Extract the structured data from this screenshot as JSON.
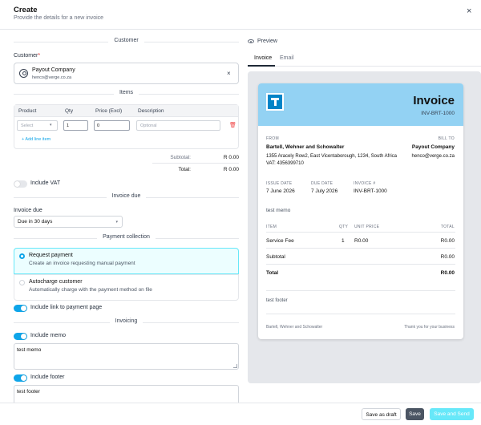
{
  "header": {
    "title": "Create",
    "subtitle": "Provide the details for a new invoice",
    "close_icon": "×"
  },
  "customer": {
    "section_title": "Customer",
    "label": "Customer",
    "required_mark": "*",
    "name": "Payout Company",
    "email": "henco@verge.co.za",
    "clear_icon": "×"
  },
  "items": {
    "section_title": "Items",
    "columns": [
      "Product",
      "Qty",
      "Price (Excl)",
      "Description"
    ],
    "row": {
      "product_placeholder": "Select",
      "qty": "1",
      "price": "0",
      "description_placeholder": "Optional"
    },
    "add_line": "+ Add line item",
    "subtotal_label": "Subtotal:",
    "subtotal_value": "R 0.00",
    "total_label": "Total:",
    "total_value": "R 0.00"
  },
  "vat": {
    "label": "Include VAT",
    "on": false
  },
  "invoice_due": {
    "section_title": "Invoice due",
    "label": "Invoice due",
    "value": "Due in 30 days"
  },
  "payment": {
    "section_title": "Payment collection",
    "options": [
      {
        "title": "Request payment",
        "desc": "Create an invoice requesting manual payment",
        "selected": true
      },
      {
        "title": "Autocharge customer",
        "desc": "Automatically charge with the payment method on file",
        "selected": false
      }
    ],
    "link_label": "Include link to payment page"
  },
  "invoicing": {
    "section_title": "Invoicing",
    "memo_label": "Include memo",
    "memo_value": "test memo",
    "footer_label": "Include footer",
    "footer_value": "test footer"
  },
  "buttons": {
    "draft": "Save as draft",
    "save": "Save",
    "send": "Save and Send"
  },
  "preview": {
    "title": "Preview",
    "tabs": [
      "Invoice",
      "Email"
    ],
    "invoice": {
      "heading": "Invoice",
      "number": "INV-BRT-1000",
      "from_label": "FROM",
      "bill_to_label": "BILL TO",
      "from_name": "Bartell, Wehner and Schowalter",
      "bill_to_name": "Payout Company",
      "address": "1355 Aracely Row2, East Vicentaborough, 1234, South Africa",
      "bill_to_email": "henco@verge.co.za",
      "vat": "VAT: 4356399710",
      "issue_date_label": "ISSUE DATE",
      "issue_date": "7 June 2026",
      "due_date_label": "DUE DATE",
      "due_date": "7 July 2026",
      "invoice_no_label": "INVOICE #",
      "invoice_no": "INV-BRT-1000",
      "memo": "test memo",
      "col_item": "ITEM",
      "col_qty": "QTY",
      "col_unit": "UNIT PRICE",
      "col_total": "TOTAL",
      "line_item": "Service Fee",
      "line_qty": "1",
      "line_unit": "R0.00",
      "line_total": "R0.00",
      "subtotal_label": "Subtotal",
      "subtotal": "R0.00",
      "total_label": "Total",
      "total": "R0.00",
      "footer_note": "test footer",
      "foot_left": "Bartell, Wehner and Schowalter",
      "foot_right": "Thank you for your business"
    }
  }
}
